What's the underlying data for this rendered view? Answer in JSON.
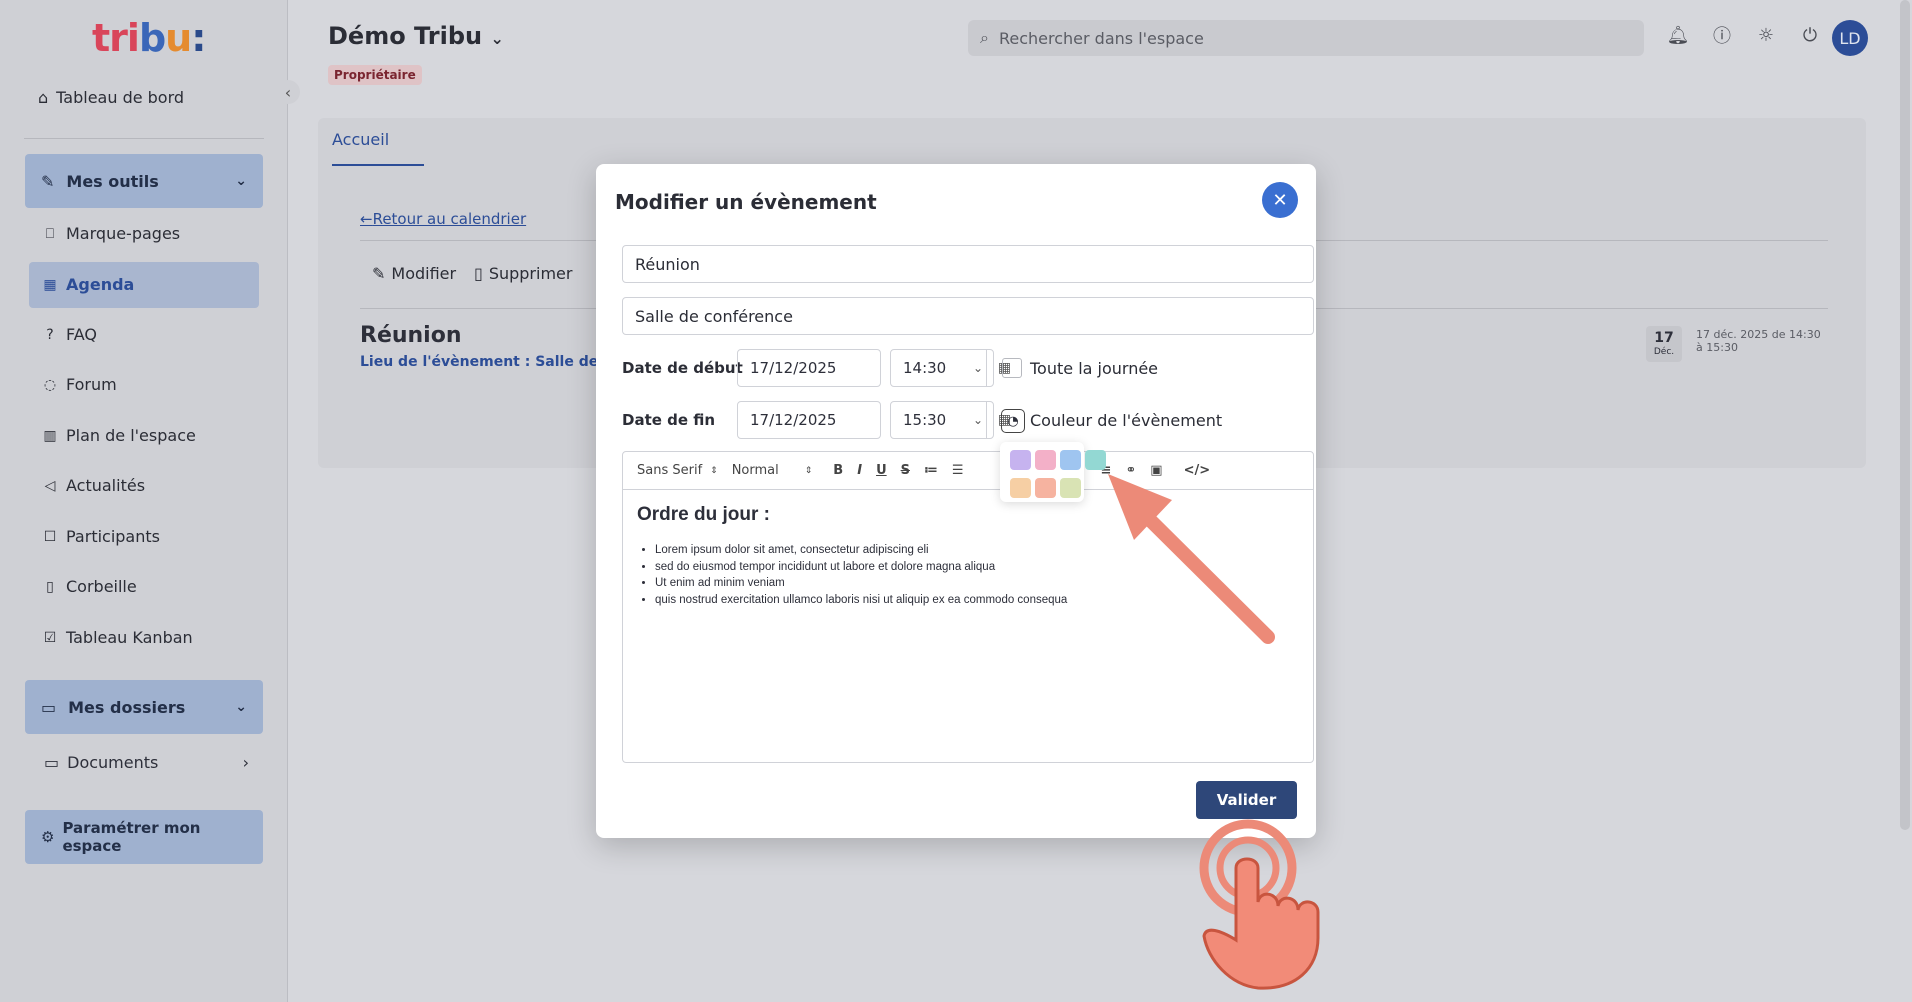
{
  "sidebar": {
    "logo": {
      "p1": "tri",
      "p2": "b",
      "p3": "u",
      "p4": ":"
    },
    "dashboard": "Tableau de bord",
    "tools_group": "Mes outils",
    "items": [
      "Marque-pages",
      "Agenda",
      "FAQ",
      "Forum",
      "Plan de l'espace",
      "Actualités",
      "Participants",
      "Corbeille",
      "Tableau Kanban"
    ],
    "folders_group": "Mes dossiers",
    "documents": "Documents",
    "settings": "Paramétrer mon espace"
  },
  "header": {
    "space_name": "Démo Tribu",
    "role_badge": "Propriétaire",
    "search_placeholder": "Rechercher dans l'espace",
    "avatar": "LD"
  },
  "page": {
    "tab": "Accueil",
    "back_link": "Retour au calendrier",
    "actions": [
      "Modifier",
      "Supprimer"
    ],
    "event_title": "Réunion",
    "event_place": "Lieu de l'évènement : Salle de co",
    "date_day": "17",
    "date_month": "Déc.",
    "date_text": "17 déc. 2025 de 14:30 à 15:30"
  },
  "modal": {
    "title": "Modifier un évènement",
    "title_value": "Réunion",
    "place_value": "Salle de conférence",
    "start_label": "Date de début",
    "start_date": "17/12/2025",
    "start_time": "14:30",
    "all_day": "Toute la journée",
    "end_label": "Date de fin",
    "end_date": "17/12/2025",
    "end_time": "15:30",
    "color_label": "Couleur de l'évènement",
    "toolbar": {
      "font": "Sans Serif",
      "size": "Normal"
    },
    "editor": {
      "heading": "Ordre du jour :",
      "bullets": [
        "Lorem ipsum dolor sit amet, consectetur adipiscing eli",
        "sed do eiusmod tempor incididunt ut labore et dolore magna aliqua",
        "Ut enim ad minim veniam",
        "quis nostrud exercitation ullamco laboris nisi ut aliquip ex ea commodo consequa"
      ]
    },
    "palette": [
      "#c6b3ef",
      "#f3b0c8",
      "#9fc5f0",
      "#93d8d3",
      "#f6cfa4",
      "#f6b3a0",
      "#d9e3b4"
    ],
    "submit": "Valider"
  }
}
